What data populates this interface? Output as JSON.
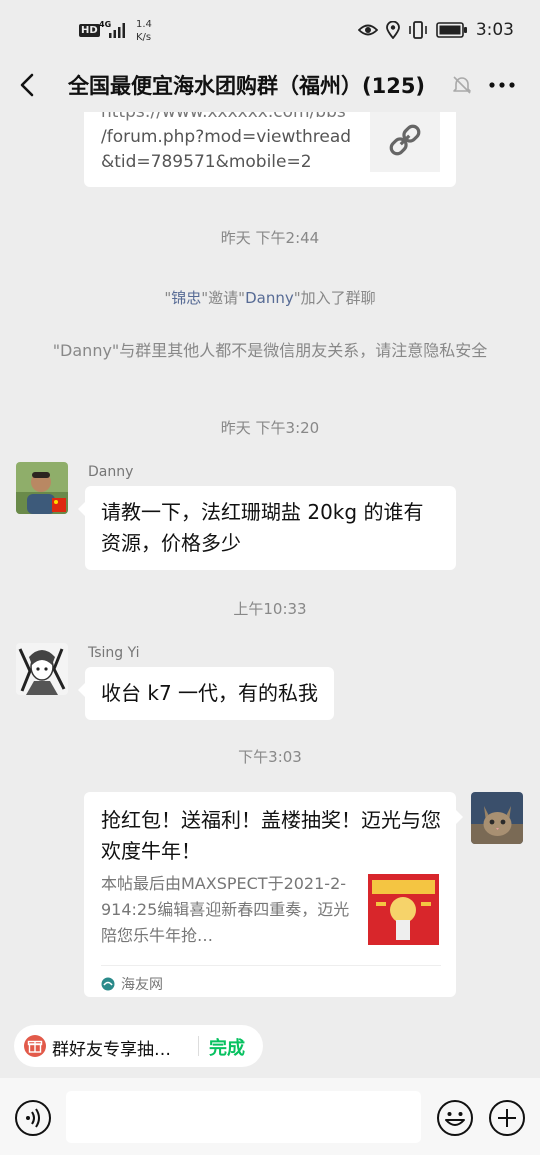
{
  "status_bar": {
    "hd": "HD",
    "network": "4G",
    "speed_value": "1.4",
    "speed_unit": "K/s",
    "time": "3:03"
  },
  "header": {
    "title": "全国最便宜海水团购群（福州）(125)"
  },
  "chat": {
    "link_card": {
      "url_partial": "https://www.xxxxxx.com/bbs",
      "url_line1": "/forum.php?mod=viewthread",
      "url_line2": "&tid=789571&mobile=2"
    },
    "time1": "昨天 下午2:44",
    "invite": {
      "q1": "\"",
      "inviter": "锦忠",
      "q2": "\"邀请\"",
      "invitee": "Danny",
      "q3": "\"加入了群聊"
    },
    "notice": "\"Danny\"与群里其他人都不是微信朋友关系，请注意隐私安全",
    "time2": "昨天 下午3:20",
    "msg1": {
      "sender": "Danny",
      "text": "请教一下，法红珊瑚盐 20kg 的谁有资源，价格多少"
    },
    "time3": "上午10:33",
    "msg2": {
      "sender": "Tsing Yi",
      "text": "收台 k7 一代，有的私我"
    },
    "time4": "下午3:03",
    "share": {
      "title": "抢红包！送福利！盖楼抽奖！迈光与您欢度牛年！",
      "desc": "本帖最后由MAXSPECT于2021-2-914:25编辑喜迎新春四重奏，迈光陪您乐牛年抢…",
      "source": "海友网"
    }
  },
  "bottom": {
    "pinned_text": "群好友专享抽…",
    "pinned_done": "完成"
  },
  "colors": {
    "background": "#ededed",
    "bubble": "#ffffff",
    "link_blue": "#576b95",
    "wechat_green": "#07c160"
  }
}
